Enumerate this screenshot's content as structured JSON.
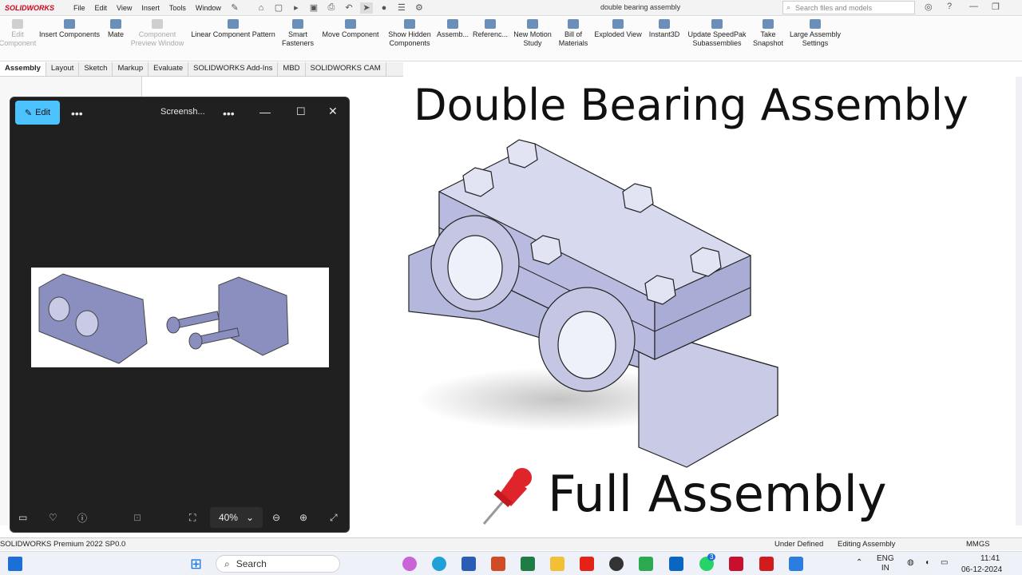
{
  "app": {
    "logo": "SOLIDWORKS",
    "document_title": "double bearing assembly",
    "search_placeholder": "Search files and models",
    "menus": [
      "File",
      "Edit",
      "View",
      "Insert",
      "Tools",
      "Window"
    ]
  },
  "toolbar": {
    "buttons": [
      {
        "label": "Edit\nComponent",
        "disabled": true
      },
      {
        "label": "Insert Components",
        "disabled": false
      },
      {
        "label": "Mate",
        "disabled": false
      },
      {
        "label": "Component\nPreview Window",
        "disabled": true
      },
      {
        "label": "Linear Component Pattern",
        "disabled": false
      },
      {
        "label": "Smart\nFasteners",
        "disabled": false
      },
      {
        "label": "Move Component",
        "disabled": false
      },
      {
        "label": "Show Hidden\nComponents",
        "disabled": false
      },
      {
        "label": "Assemb...",
        "disabled": false
      },
      {
        "label": "Referenc...",
        "disabled": false
      },
      {
        "label": "New Motion\nStudy",
        "disabled": false
      },
      {
        "label": "Bill of\nMaterials",
        "disabled": false
      },
      {
        "label": "Exploded View",
        "disabled": false
      },
      {
        "label": "Instant3D",
        "disabled": false
      },
      {
        "label": "Update SpeedPak\nSubassemblies",
        "disabled": false
      },
      {
        "label": "Take\nSnapshot",
        "disabled": false
      },
      {
        "label": "Large Assembly\nSettings",
        "disabled": false
      }
    ]
  },
  "tabs": [
    "Assembly",
    "Layout",
    "Sketch",
    "Markup",
    "Evaluate",
    "SOLIDWORKS Add-Ins",
    "MBD",
    "SOLIDWORKS CAM"
  ],
  "overlay": {
    "title": "Double Bearing Assembly",
    "caption": "Full Assembly"
  },
  "viewer": {
    "edit_label": "Edit",
    "title": "Screensh...",
    "zoom": "40%"
  },
  "status": {
    "product": "SOLIDWORKS Premium 2022 SP0.0",
    "state": "Under Defined",
    "mode": "Editing Assembly",
    "units": "MMGS"
  },
  "taskbar": {
    "search": "Search",
    "language": "ENG\nIN",
    "time": "11:41",
    "date": "06-12-2024",
    "badge": "3"
  },
  "colors": {
    "model_face": "#c9cbe6",
    "model_dark": "#a9acd4",
    "accent": "#4cc2ff"
  }
}
